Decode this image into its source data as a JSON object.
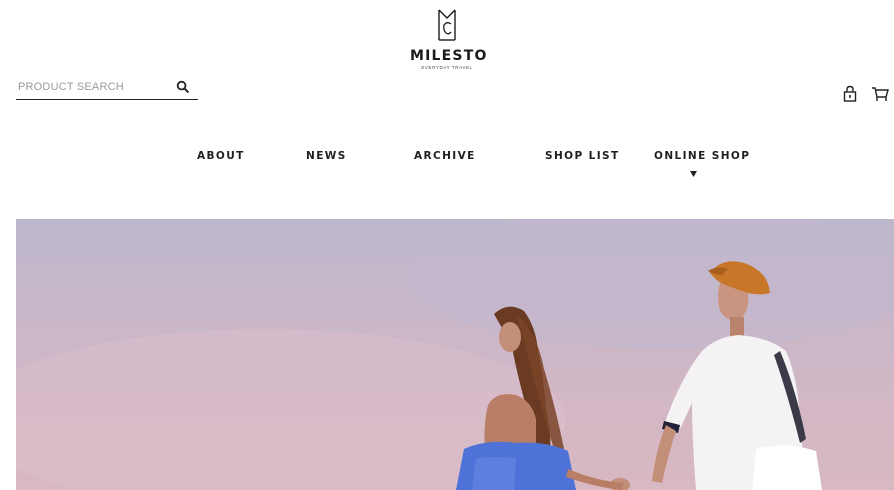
{
  "search": {
    "placeholder": "PRODUCT SEARCH"
  },
  "brand": {
    "name": "MILESTO",
    "tagline": "EVERYDAY TRAVEL"
  },
  "header_icons": [
    "lock-icon",
    "cart-icon"
  ],
  "nav": {
    "items": [
      {
        "label": "ABOUT"
      },
      {
        "label": "NEWS"
      },
      {
        "label": "ARCHIVE"
      },
      {
        "label": "SHOP LIST"
      },
      {
        "label": "ONLINE SHOP"
      }
    ],
    "dropdown_indicator": "caret-down-icon"
  },
  "colors": {
    "text": "#1f1f1f",
    "sky_top": "#bdb7cb",
    "sky_bottom": "#d8b8c2",
    "cap": "#c8762a",
    "dress": "#4f72d8"
  }
}
